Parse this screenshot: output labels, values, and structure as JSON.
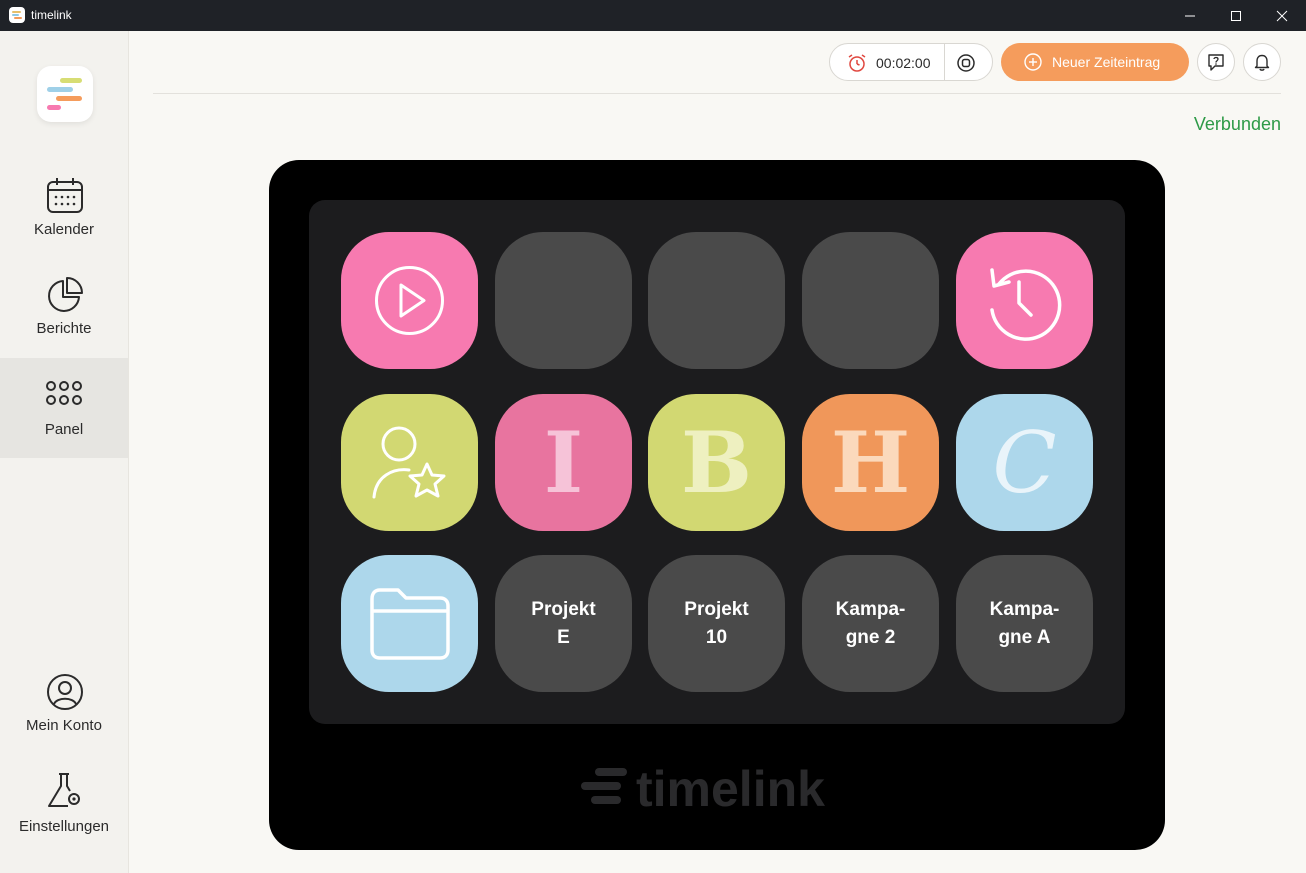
{
  "window": {
    "title": "timelink",
    "controls": [
      "minimize-icon",
      "maximize-icon",
      "close-icon"
    ]
  },
  "sidebar": {
    "items": [
      {
        "label": "Kalender",
        "icon": "calendar-icon"
      },
      {
        "label": "Berichte",
        "icon": "pie-chart-icon"
      },
      {
        "label": "Panel",
        "icon": "grid-icon",
        "active": true
      },
      {
        "label": "Mein Konto",
        "icon": "user-icon"
      },
      {
        "label": "Einstellungen",
        "icon": "flask-gear-icon"
      }
    ]
  },
  "header": {
    "timer_value": "00:02:00",
    "new_entry_label": "Neuer Zeiteintrag",
    "status": "Verbunden"
  },
  "colors": {
    "accent": "#f59c5c",
    "status": "#2e9a47",
    "pink": "#f77ab0",
    "lime": "#d2d872",
    "orange": "#f0975a",
    "lightblue": "#add7eb",
    "gray": "#4a4a4a"
  },
  "panel": {
    "keys": [
      {
        "name": "play",
        "icon": "play-icon",
        "color": "#f77ab0"
      },
      {
        "name": "empty-1",
        "color": "#4a4a4a"
      },
      {
        "name": "empty-2",
        "color": "#4a4a4a"
      },
      {
        "name": "empty-3",
        "color": "#4a4a4a"
      },
      {
        "name": "history",
        "icon": "history-icon",
        "color": "#f77ab0"
      },
      {
        "name": "favorite-user",
        "icon": "user-star-icon",
        "color": "#d2d872"
      },
      {
        "name": "letter-i",
        "letter": "I",
        "color": "#e8749f"
      },
      {
        "name": "letter-b",
        "letter": "B",
        "color": "#d2d872"
      },
      {
        "name": "letter-h",
        "letter": "H",
        "color": "#f0975a"
      },
      {
        "name": "letter-c",
        "letter": "C",
        "color": "#add7eb"
      },
      {
        "name": "folder",
        "icon": "folder-icon",
        "color": "#add7eb"
      },
      {
        "name": "projekt-e",
        "label": "Projekt\nE",
        "color": "#4a4a4a"
      },
      {
        "name": "projekt-10",
        "label": "Projekt\n10",
        "color": "#4a4a4a"
      },
      {
        "name": "kampagne-2",
        "label": "Kampa-\ngne 2",
        "color": "#4a4a4a"
      },
      {
        "name": "kampagne-a",
        "label": "Kampa-\ngne A",
        "color": "#4a4a4a"
      }
    ],
    "brand": "timelink"
  }
}
